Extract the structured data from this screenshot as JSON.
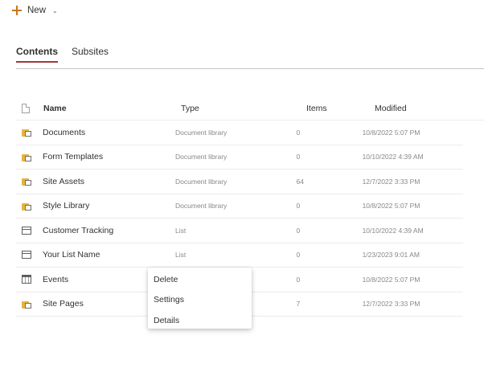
{
  "command_bar": {
    "new_label": "New",
    "new_icon": "plus-icon",
    "dropdown_icon": "chevron-down-icon"
  },
  "tabs": [
    {
      "label": "Contents",
      "active": true
    },
    {
      "label": "Subsites",
      "active": false
    }
  ],
  "accent_color": "#a4373a",
  "table": {
    "headers": {
      "name": "Name",
      "type": "Type",
      "items": "Items",
      "modified": "Modified"
    },
    "rows": [
      {
        "icon": "document-library-icon",
        "name": "Documents",
        "type": "Document library",
        "items": "0",
        "modified": "10/8/2022 5:07 PM"
      },
      {
        "icon": "document-library-icon",
        "name": "Form Templates",
        "type": "Document library",
        "items": "0",
        "modified": "10/10/2022 4:39 AM"
      },
      {
        "icon": "document-library-icon",
        "name": "Site Assets",
        "type": "Document library",
        "items": "64",
        "modified": "12/7/2022 3:33 PM"
      },
      {
        "icon": "document-library-icon",
        "name": "Style Library",
        "type": "Document library",
        "items": "0",
        "modified": "10/8/2022 5:07 PM"
      },
      {
        "icon": "list-icon",
        "name": "Customer Tracking",
        "type": "List",
        "items": "0",
        "modified": "10/10/2022 4:39 AM"
      },
      {
        "icon": "list-icon",
        "name": "Your List Name",
        "type": "List",
        "items": "0",
        "modified": "1/23/2023 9:01 AM"
      },
      {
        "icon": "calendar-icon",
        "name": "Events",
        "type": "",
        "items": "0",
        "modified": "10/8/2022 5:07 PM"
      },
      {
        "icon": "document-library-icon",
        "name": "Site Pages",
        "type": "",
        "items": "7",
        "modified": "12/7/2022 3:33 PM"
      }
    ]
  },
  "context_menu": {
    "items": [
      "Delete",
      "Settings",
      "Details"
    ]
  }
}
